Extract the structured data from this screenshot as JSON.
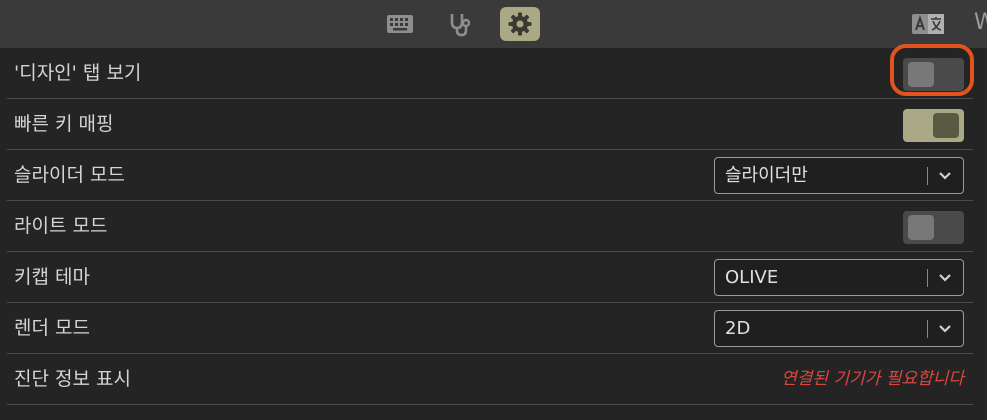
{
  "toolbar": {
    "icons": [
      "keyboard-icon",
      "stethoscope-icon",
      "gear-icon",
      "translate-icon"
    ],
    "active": "gear-icon",
    "trailing_glyph": "W"
  },
  "settings": {
    "design_tab": {
      "label": "'디자인' 탭 보기",
      "toggle": "off",
      "highlighted": true
    },
    "quick_key_mapping": {
      "label": "빠른 키 매핑",
      "toggle": "on"
    },
    "slider_mode": {
      "label": "슬라이더 모드",
      "value": "슬라이더만"
    },
    "light_mode": {
      "label": "라이트 모드",
      "toggle": "off"
    },
    "keycap_theme": {
      "label": "키캡 테마",
      "value": "OLIVE"
    },
    "render_mode": {
      "label": "렌더 모드",
      "value": "2D"
    },
    "diagnostics": {
      "label": "진단 정보 표시",
      "status": "연결된 기기가 필요합니다"
    }
  },
  "colors": {
    "accent": "#a9a985",
    "highlight": "#e2541e",
    "error": "#d9473d",
    "background": "#242424",
    "toolbar": "#3a3a3a"
  }
}
